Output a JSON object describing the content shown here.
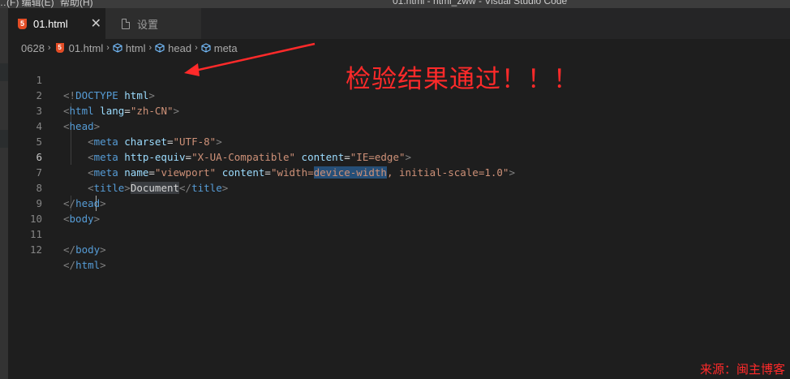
{
  "window": {
    "menu_fragment_1": "…(F)  编辑(E)",
    "menu_fragment_2": "帮助(H)",
    "title": "01.html - html_zww - Visual Studio Code"
  },
  "tabs": [
    {
      "label": "01.html",
      "icon": "html5-icon",
      "active": true,
      "close_symbol": "✕"
    },
    {
      "label": "设置",
      "icon": "file-icon",
      "active": false
    }
  ],
  "breadcrumb": {
    "items": [
      "0628",
      "01.html",
      "html",
      "head",
      "meta"
    ],
    "separator": "›"
  },
  "editor": {
    "current_line": 6,
    "selected_text": "device-width",
    "lines": [
      {
        "num": "1",
        "text": "<!DOCTYPE html>"
      },
      {
        "num": "2",
        "text": "<html lang=\"zh-CN\">"
      },
      {
        "num": "3",
        "text": "<head>"
      },
      {
        "num": "4",
        "text": "    <meta charset=\"UTF-8\">"
      },
      {
        "num": "5",
        "text": "    <meta http-equiv=\"X-UA-Compatible\" content=\"IE=edge\">"
      },
      {
        "num": "6",
        "text": "    <meta name=\"viewport\" content=\"width=device-width, initial-scale=1.0\">"
      },
      {
        "num": "7",
        "text": "    <title>Document</title>"
      },
      {
        "num": "8",
        "text": "</head>"
      },
      {
        "num": "9",
        "text": "<body>"
      },
      {
        "num": "10",
        "text": ""
      },
      {
        "num": "11",
        "text": "</body>"
      },
      {
        "num": "12",
        "text": "</html>"
      }
    ]
  },
  "annotation": {
    "text": "检验结果通过！！！",
    "color": "#ff2a2a"
  },
  "watermark": {
    "text": "来源：闽主博客"
  },
  "colors": {
    "background": "#1e1e1e",
    "tag_name": "#569cd6",
    "attribute": "#9cdcfe",
    "string": "#ce9178",
    "punctuation": "#808080",
    "selection": "#264f78"
  }
}
